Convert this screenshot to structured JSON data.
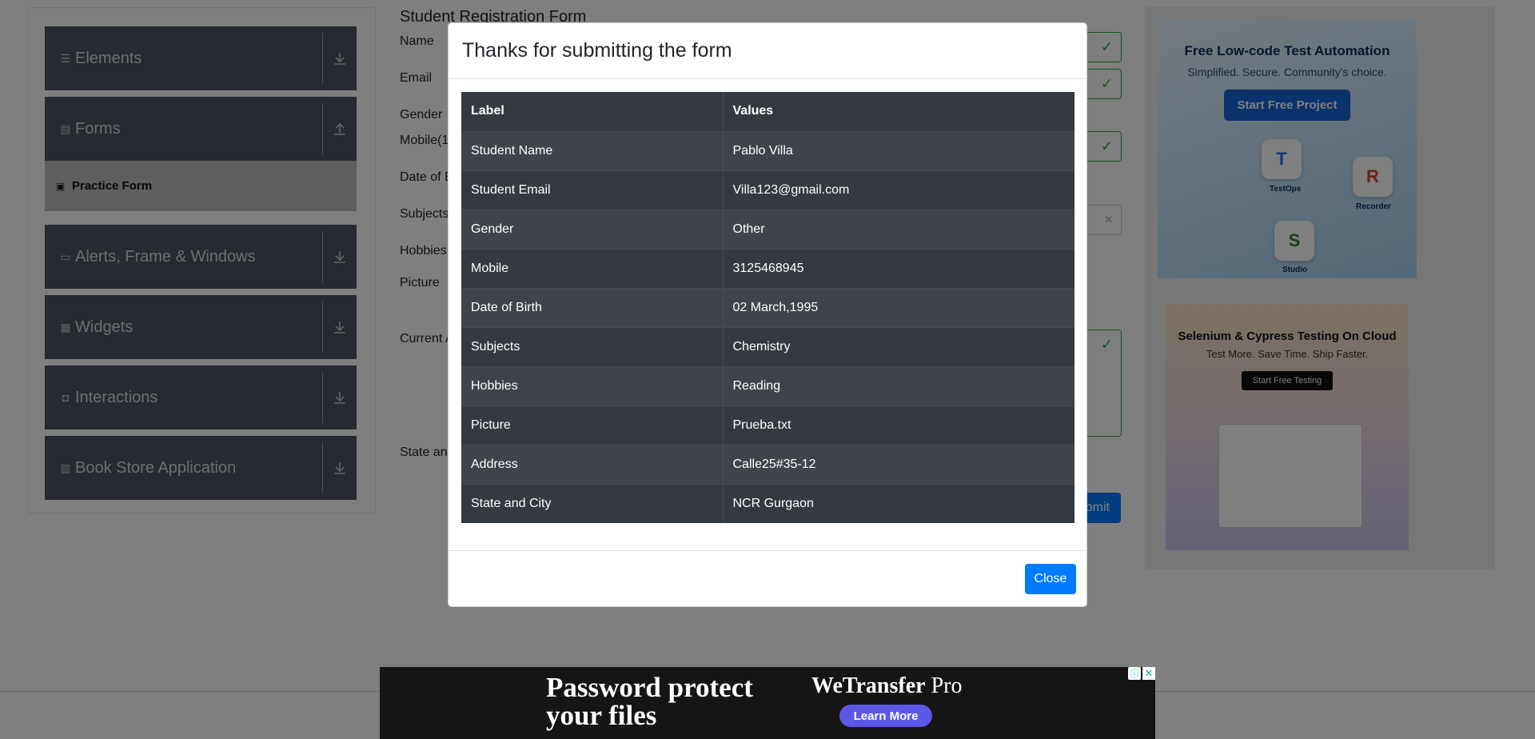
{
  "sidebar": {
    "groups": [
      {
        "label": "Elements",
        "icon": "list-icon",
        "arrow": "download-icon"
      },
      {
        "label": "Forms",
        "icon": "document-icon",
        "arrow": "upload-icon"
      },
      {
        "label": "Alerts, Frame & Windows",
        "icon": "window-icon",
        "arrow": "download-icon"
      },
      {
        "label": "Widgets",
        "icon": "grid-icon",
        "arrow": "download-icon"
      },
      {
        "label": "Interactions",
        "icon": "interaction-icon",
        "arrow": "download-icon"
      },
      {
        "label": "Book Store Application",
        "icon": "books-icon",
        "arrow": "download-icon"
      }
    ],
    "active_item": "Practice Form"
  },
  "form": {
    "title": "Student Registration Form",
    "labels": {
      "name": "Name",
      "email": "Email",
      "gender": "Gender",
      "mobile": "Mobile(1",
      "dob": "Date of B",
      "subjects": "Subjects",
      "hobbies": "Hobbies",
      "picture": "Picture",
      "address": "Current A",
      "state": "State and"
    },
    "submit_label": "bmit",
    "subjects_clear": "×"
  },
  "ads": {
    "top": {
      "title": "Free Low-code Test Automation",
      "subtitle": "Simplified. Secure. Community's choice.",
      "button": "Start Free Project",
      "tiles": [
        "TestOps",
        "Recorder",
        "Studio"
      ]
    },
    "bottom": {
      "title": "Selenium & Cypress Testing On Cloud",
      "subtitle": "Test More. Save Time. Ship Faster.",
      "button": "Start Free Testing"
    },
    "banner": {
      "headline_1": "Password protect",
      "headline_2": "your files",
      "brand": "WeTransfer",
      "brand_suffix": "Pro",
      "cta": "Learn More"
    }
  },
  "modal": {
    "title": "Thanks for submitting the form",
    "columns": [
      "Label",
      "Values"
    ],
    "rows": [
      [
        "Student Name",
        "Pablo Villa"
      ],
      [
        "Student Email",
        "Villa123@gmail.com"
      ],
      [
        "Gender",
        "Other"
      ],
      [
        "Mobile",
        "3125468945"
      ],
      [
        "Date of Birth",
        "02 March,1995"
      ],
      [
        "Subjects",
        "Chemistry"
      ],
      [
        "Hobbies",
        "Reading"
      ],
      [
        "Picture",
        "Prueba.txt"
      ],
      [
        "Address",
        "Calle25#35-12"
      ],
      [
        "State and City",
        "NCR Gurgaon"
      ]
    ],
    "close_label": "Close"
  },
  "colors": {
    "primary": "#007bff",
    "success": "#28a745",
    "table_dark": "#343a40",
    "menu_bg": "#4e5560"
  }
}
